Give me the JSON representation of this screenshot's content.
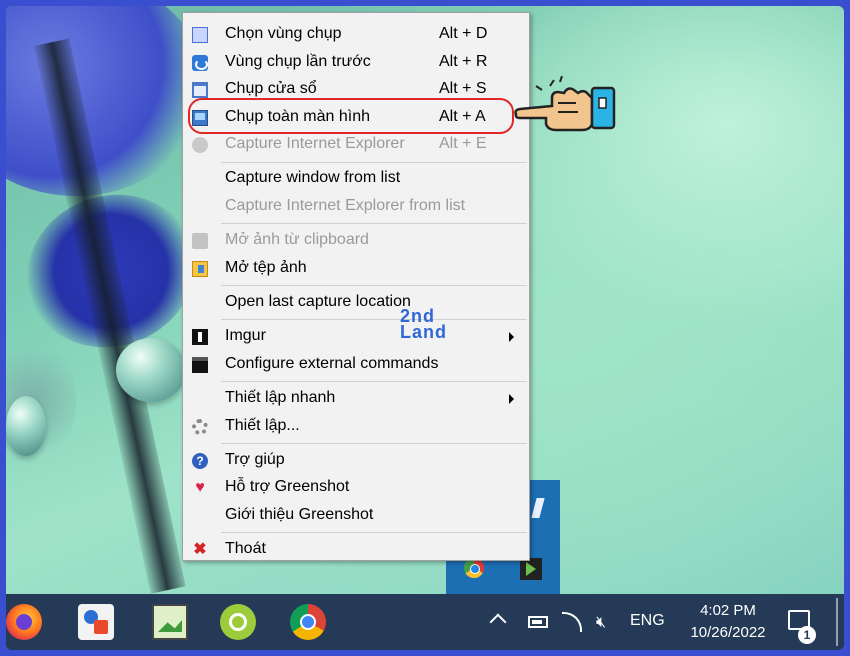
{
  "menu": {
    "items": [
      {
        "label": "Chọn vùng chụp",
        "shortcut": "Alt + D",
        "icon": "region-capture-icon",
        "disabled": false
      },
      {
        "label": "Vùng chụp lần trước",
        "shortcut": "Alt + R",
        "icon": "last-region-icon",
        "disabled": false
      },
      {
        "label": "Chụp cửa sổ",
        "shortcut": "Alt + S",
        "icon": "window-capture-icon",
        "disabled": false
      },
      {
        "label": "Chụp toàn màn hình",
        "shortcut": "Alt + A",
        "icon": "fullscreen-capture-icon",
        "disabled": false
      },
      {
        "label": "Capture Internet Explorer",
        "shortcut": "Alt + E",
        "icon": "internet-explorer-icon",
        "disabled": true
      },
      {
        "label": "Capture window from list",
        "disabled": false
      },
      {
        "label": "Capture Internet Explorer from list",
        "disabled": true
      },
      {
        "label": "Mở ảnh từ clipboard",
        "icon": "clipboard-icon",
        "disabled": true
      },
      {
        "label": "Mở tệp ảnh",
        "icon": "open-file-icon",
        "disabled": false
      },
      {
        "label": "Open last capture location",
        "disabled": false
      },
      {
        "label": "Imgur",
        "icon": "imgur-icon",
        "submenu": true,
        "disabled": false
      },
      {
        "label": "Configure external commands",
        "icon": "terminal-icon",
        "disabled": false
      },
      {
        "label": "Thiết lập nhanh",
        "submenu": true,
        "disabled": false
      },
      {
        "label": "Thiết lập...",
        "icon": "gear-icon",
        "disabled": false
      },
      {
        "label": "Trợ giúp",
        "icon": "help-icon",
        "disabled": false
      },
      {
        "label": "Hỗ trợ Greenshot",
        "icon": "heart-icon",
        "disabled": false
      },
      {
        "label": "Giới thiệu Greenshot",
        "disabled": false
      },
      {
        "label": "Thoát",
        "icon": "exit-icon",
        "disabled": false
      }
    ]
  },
  "watermark": {
    "line1": "2nd",
    "line2": "Land"
  },
  "taskbar": {
    "apps": [
      "firefox-icon",
      "software-center-icon",
      "image-editor-icon",
      "green-app-icon",
      "chrome-icon"
    ],
    "language": "ENG",
    "time": "4:02 PM",
    "date": "10/26/2022",
    "notification_count": "1"
  },
  "colors": {
    "highlight_ring": "#e02828",
    "taskbar": "#243a56",
    "menu_bg": "#f2f2f2"
  }
}
